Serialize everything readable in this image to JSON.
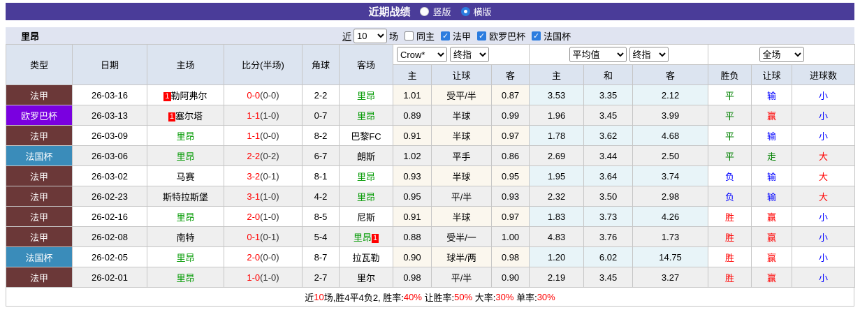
{
  "titlebar": {
    "title": "近期战绩",
    "options": [
      {
        "label": "竖版",
        "selected": false
      },
      {
        "label": "横版",
        "selected": true
      }
    ]
  },
  "filterbar": {
    "team": "里昂",
    "near": "近",
    "count": "10",
    "unit": "场",
    "same_home": "同主",
    "league_filters": [
      {
        "label": "法甲",
        "checked": true
      },
      {
        "label": "欧罗巴杯",
        "checked": true
      },
      {
        "label": "法国杯",
        "checked": true
      }
    ]
  },
  "table": {
    "static_headers": [
      "类型",
      "日期",
      "主场",
      "比分(半场)",
      "角球",
      "客场"
    ],
    "selects": {
      "bookmaker": "Crow*",
      "bookmaker_stage": "终指",
      "average": "平均值",
      "average_stage": "终指",
      "scope": "全场"
    },
    "sub_headers": [
      "主",
      "让球",
      "客",
      "主",
      "和",
      "客",
      "胜负",
      "让球",
      "进球数"
    ],
    "rows": [
      {
        "type": "法甲",
        "type_color": "#6b3838",
        "date": "26-03-16",
        "home_badge": "1",
        "home": "勒阿弗尔",
        "home_color": "#000000",
        "score": "0-0",
        "half": "(0-0)",
        "corner": "2-2",
        "away": "里昂",
        "away_color": "#009900",
        "away_badge": "",
        "ah_home": "1.01",
        "ah_line": "受平/半",
        "ah_away": "0.87",
        "eu_home": "3.53",
        "eu_draw": "3.35",
        "eu_away": "2.12",
        "result": "平",
        "result_color": "#008000",
        "ah_result": "输",
        "ah_result_color": "#0000ff",
        "goal_result": "小",
        "goal_result_color": "#0000ff"
      },
      {
        "type": "欧罗巴杯",
        "type_color": "#7a00e0",
        "date": "26-03-13",
        "home_badge": "1",
        "home": "塞尔塔",
        "home_color": "#000000",
        "score": "1-1",
        "half": "(1-0)",
        "corner": "0-7",
        "away": "里昂",
        "away_color": "#009900",
        "away_badge": "",
        "ah_home": "0.89",
        "ah_line": "半球",
        "ah_away": "0.99",
        "eu_home": "1.96",
        "eu_draw": "3.45",
        "eu_away": "3.99",
        "result": "平",
        "result_color": "#008000",
        "ah_result": "赢",
        "ah_result_color": "#ff0000",
        "goal_result": "小",
        "goal_result_color": "#0000ff"
      },
      {
        "type": "法甲",
        "type_color": "#6b3838",
        "date": "26-03-09",
        "home_badge": "",
        "home": "里昂",
        "home_color": "#009900",
        "score": "1-1",
        "half": "(0-0)",
        "corner": "8-2",
        "away": "巴黎FC",
        "away_color": "#000000",
        "away_badge": "",
        "ah_home": "0.91",
        "ah_line": "半球",
        "ah_away": "0.97",
        "eu_home": "1.78",
        "eu_draw": "3.62",
        "eu_away": "4.68",
        "result": "平",
        "result_color": "#008000",
        "ah_result": "输",
        "ah_result_color": "#0000ff",
        "goal_result": "小",
        "goal_result_color": "#0000ff"
      },
      {
        "type": "法国杯",
        "type_color": "#3a8cba",
        "date": "26-03-06",
        "home_badge": "",
        "home": "里昂",
        "home_color": "#009900",
        "score": "2-2",
        "half": "(0-2)",
        "corner": "6-7",
        "away": "朗斯",
        "away_color": "#000000",
        "away_badge": "",
        "ah_home": "1.02",
        "ah_line": "平手",
        "ah_away": "0.86",
        "eu_home": "2.69",
        "eu_draw": "3.44",
        "eu_away": "2.50",
        "result": "平",
        "result_color": "#008000",
        "ah_result": "走",
        "ah_result_color": "#008000",
        "goal_result": "大",
        "goal_result_color": "#ff0000"
      },
      {
        "type": "法甲",
        "type_color": "#6b3838",
        "date": "26-03-02",
        "home_badge": "",
        "home": "马赛",
        "home_color": "#000000",
        "score": "3-2",
        "half": "(0-1)",
        "corner": "8-1",
        "away": "里昂",
        "away_color": "#009900",
        "away_badge": "",
        "ah_home": "0.93",
        "ah_line": "半球",
        "ah_away": "0.95",
        "eu_home": "1.95",
        "eu_draw": "3.64",
        "eu_away": "3.74",
        "result": "负",
        "result_color": "#0000ff",
        "ah_result": "输",
        "ah_result_color": "#0000ff",
        "goal_result": "大",
        "goal_result_color": "#ff0000"
      },
      {
        "type": "法甲",
        "type_color": "#6b3838",
        "date": "26-02-23",
        "home_badge": "",
        "home": "斯特拉斯堡",
        "home_color": "#000000",
        "score": "3-1",
        "half": "(1-0)",
        "corner": "4-2",
        "away": "里昂",
        "away_color": "#009900",
        "away_badge": "",
        "ah_home": "0.95",
        "ah_line": "平/半",
        "ah_away": "0.93",
        "eu_home": "2.32",
        "eu_draw": "3.50",
        "eu_away": "2.98",
        "result": "负",
        "result_color": "#0000ff",
        "ah_result": "输",
        "ah_result_color": "#0000ff",
        "goal_result": "大",
        "goal_result_color": "#ff0000"
      },
      {
        "type": "法甲",
        "type_color": "#6b3838",
        "date": "26-02-16",
        "home_badge": "",
        "home": "里昂",
        "home_color": "#009900",
        "score": "2-0",
        "half": "(1-0)",
        "corner": "8-5",
        "away": "尼斯",
        "away_color": "#000000",
        "away_badge": "",
        "ah_home": "0.91",
        "ah_line": "半球",
        "ah_away": "0.97",
        "eu_home": "1.83",
        "eu_draw": "3.73",
        "eu_away": "4.26",
        "result": "胜",
        "result_color": "#ff0000",
        "ah_result": "赢",
        "ah_result_color": "#ff0000",
        "goal_result": "小",
        "goal_result_color": "#0000ff"
      },
      {
        "type": "法甲",
        "type_color": "#6b3838",
        "date": "26-02-08",
        "home_badge": "",
        "home": "南特",
        "home_color": "#000000",
        "score": "0-1",
        "half": "(0-1)",
        "corner": "5-4",
        "away": "里昂",
        "away_color": "#009900",
        "away_badge": "1",
        "ah_home": "0.88",
        "ah_line": "受半/一",
        "ah_away": "1.00",
        "eu_home": "4.83",
        "eu_draw": "3.76",
        "eu_away": "1.73",
        "result": "胜",
        "result_color": "#ff0000",
        "ah_result": "赢",
        "ah_result_color": "#ff0000",
        "goal_result": "小",
        "goal_result_color": "#0000ff"
      },
      {
        "type": "法国杯",
        "type_color": "#3a8cba",
        "date": "26-02-05",
        "home_badge": "",
        "home": "里昂",
        "home_color": "#009900",
        "score": "2-0",
        "half": "(0-0)",
        "corner": "8-7",
        "away": "拉瓦勒",
        "away_color": "#000000",
        "away_badge": "",
        "ah_home": "0.90",
        "ah_line": "球半/两",
        "ah_away": "0.98",
        "eu_home": "1.20",
        "eu_draw": "6.02",
        "eu_away": "14.75",
        "result": "胜",
        "result_color": "#ff0000",
        "ah_result": "赢",
        "ah_result_color": "#ff0000",
        "goal_result": "小",
        "goal_result_color": "#0000ff"
      },
      {
        "type": "法甲",
        "type_color": "#6b3838",
        "date": "26-02-01",
        "home_badge": "",
        "home": "里昂",
        "home_color": "#009900",
        "score": "1-0",
        "half": "(1-0)",
        "corner": "2-7",
        "away": "里尔",
        "away_color": "#000000",
        "away_badge": "",
        "ah_home": "0.98",
        "ah_line": "平/半",
        "ah_away": "0.90",
        "eu_home": "2.19",
        "eu_draw": "3.45",
        "eu_away": "3.27",
        "result": "胜",
        "result_color": "#ff0000",
        "ah_result": "赢",
        "ah_result_color": "#ff0000",
        "goal_result": "小",
        "goal_result_color": "#0000ff"
      }
    ]
  },
  "footer": {
    "segments": [
      {
        "text": "近",
        "color": "#000000"
      },
      {
        "text": "10",
        "color": "#ff0000"
      },
      {
        "text": "场,胜4平4负2, 胜率:",
        "color": "#000000"
      },
      {
        "text": "40%",
        "color": "#ff0000"
      },
      {
        "text": " 让胜率:",
        "color": "#000000"
      },
      {
        "text": "50%",
        "color": "#ff0000"
      },
      {
        "text": " 大率:",
        "color": "#000000"
      },
      {
        "text": "30%",
        "color": "#ff0000"
      },
      {
        "text": " 单率:",
        "color": "#000000"
      },
      {
        "text": "30%",
        "color": "#ff0000"
      }
    ]
  }
}
